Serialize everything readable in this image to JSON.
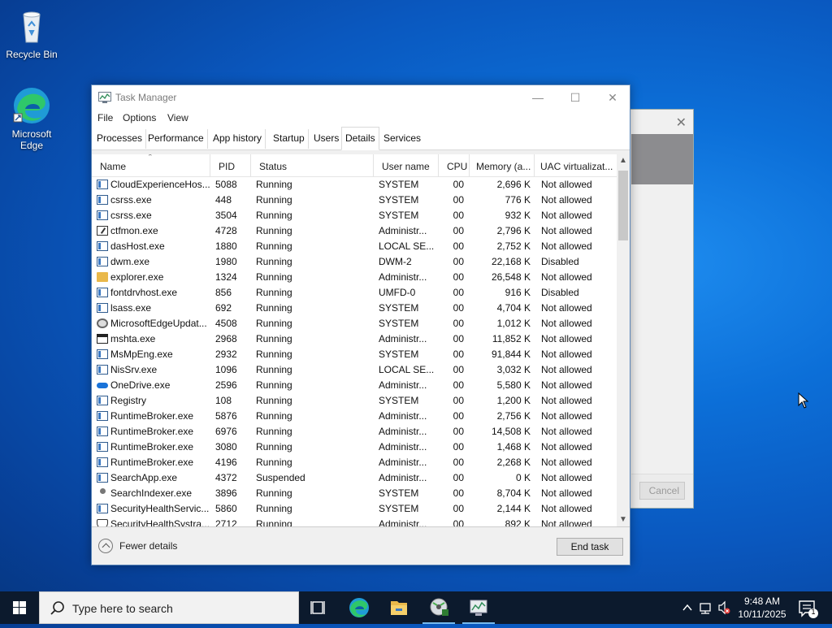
{
  "desktop": {
    "icons": [
      {
        "label": "Recycle Bin",
        "icon": "recycle-bin-icon"
      },
      {
        "label": "Microsoft Edge",
        "icon": "edge-icon"
      }
    ],
    "background_dialog": {
      "cancel_label": "Cancel"
    }
  },
  "task_manager": {
    "title": "Task Manager",
    "window_buttons": {
      "minimize": "—",
      "maximize": "☐",
      "close": "✕"
    },
    "menu": [
      "File",
      "Options",
      "View"
    ],
    "tabs": [
      "Processes",
      "Performance",
      "App history",
      "Startup",
      "Users",
      "Details",
      "Services"
    ],
    "active_tab": "Details",
    "columns": [
      "Name",
      "PID",
      "Status",
      "User name",
      "CPU",
      "Memory (a...",
      "UAC virtualizat..."
    ],
    "rows": [
      {
        "name": "CloudExperienceHos...",
        "pid": "5088",
        "status": "Running",
        "user": "SYSTEM",
        "cpu": "00",
        "mem": "2,696 K",
        "uac": "Not allowed",
        "icon": "app"
      },
      {
        "name": "csrss.exe",
        "pid": "448",
        "status": "Running",
        "user": "SYSTEM",
        "cpu": "00",
        "mem": "776 K",
        "uac": "Not allowed",
        "icon": "app"
      },
      {
        "name": "csrss.exe",
        "pid": "3504",
        "status": "Running",
        "user": "SYSTEM",
        "cpu": "00",
        "mem": "932 K",
        "uac": "Not allowed",
        "icon": "app"
      },
      {
        "name": "ctfmon.exe",
        "pid": "4728",
        "status": "Running",
        "user": "Administr...",
        "cpu": "00",
        "mem": "2,796 K",
        "uac": "Not allowed",
        "icon": "pen"
      },
      {
        "name": "dasHost.exe",
        "pid": "1880",
        "status": "Running",
        "user": "LOCAL SE...",
        "cpu": "00",
        "mem": "2,752 K",
        "uac": "Not allowed",
        "icon": "app"
      },
      {
        "name": "dwm.exe",
        "pid": "1980",
        "status": "Running",
        "user": "DWM-2",
        "cpu": "00",
        "mem": "22,168 K",
        "uac": "Disabled",
        "icon": "app"
      },
      {
        "name": "explorer.exe",
        "pid": "1324",
        "status": "Running",
        "user": "Administr...",
        "cpu": "00",
        "mem": "26,548 K",
        "uac": "Not allowed",
        "icon": "folder"
      },
      {
        "name": "fontdrvhost.exe",
        "pid": "856",
        "status": "Running",
        "user": "UMFD-0",
        "cpu": "00",
        "mem": "916 K",
        "uac": "Disabled",
        "icon": "app"
      },
      {
        "name": "lsass.exe",
        "pid": "692",
        "status": "Running",
        "user": "SYSTEM",
        "cpu": "00",
        "mem": "4,704 K",
        "uac": "Not allowed",
        "icon": "app"
      },
      {
        "name": "MicrosoftEdgeUpdat...",
        "pid": "4508",
        "status": "Running",
        "user": "SYSTEM",
        "cpu": "00",
        "mem": "1,012 K",
        "uac": "Not allowed",
        "icon": "gear"
      },
      {
        "name": "mshta.exe",
        "pid": "2968",
        "status": "Running",
        "user": "Administr...",
        "cpu": "00",
        "mem": "11,852 K",
        "uac": "Not allowed",
        "icon": "dark"
      },
      {
        "name": "MsMpEng.exe",
        "pid": "2932",
        "status": "Running",
        "user": "SYSTEM",
        "cpu": "00",
        "mem": "91,844 K",
        "uac": "Not allowed",
        "icon": "app"
      },
      {
        "name": "NisSrv.exe",
        "pid": "1096",
        "status": "Running",
        "user": "LOCAL SE...",
        "cpu": "00",
        "mem": "3,032 K",
        "uac": "Not allowed",
        "icon": "app"
      },
      {
        "name": "OneDrive.exe",
        "pid": "2596",
        "status": "Running",
        "user": "Administr...",
        "cpu": "00",
        "mem": "5,580 K",
        "uac": "Not allowed",
        "icon": "cloud"
      },
      {
        "name": "Registry",
        "pid": "108",
        "status": "Running",
        "user": "SYSTEM",
        "cpu": "00",
        "mem": "1,200 K",
        "uac": "Not allowed",
        "icon": "app"
      },
      {
        "name": "RuntimeBroker.exe",
        "pid": "5876",
        "status": "Running",
        "user": "Administr...",
        "cpu": "00",
        "mem": "2,756 K",
        "uac": "Not allowed",
        "icon": "app"
      },
      {
        "name": "RuntimeBroker.exe",
        "pid": "6976",
        "status": "Running",
        "user": "Administr...",
        "cpu": "00",
        "mem": "14,508 K",
        "uac": "Not allowed",
        "icon": "app"
      },
      {
        "name": "RuntimeBroker.exe",
        "pid": "3080",
        "status": "Running",
        "user": "Administr...",
        "cpu": "00",
        "mem": "1,468 K",
        "uac": "Not allowed",
        "icon": "app"
      },
      {
        "name": "RuntimeBroker.exe",
        "pid": "4196",
        "status": "Running",
        "user": "Administr...",
        "cpu": "00",
        "mem": "2,268 K",
        "uac": "Not allowed",
        "icon": "app"
      },
      {
        "name": "SearchApp.exe",
        "pid": "4372",
        "status": "Suspended",
        "user": "Administr...",
        "cpu": "00",
        "mem": "0 K",
        "uac": "Not allowed",
        "icon": "app"
      },
      {
        "name": "SearchIndexer.exe",
        "pid": "3896",
        "status": "Running",
        "user": "SYSTEM",
        "cpu": "00",
        "mem": "8,704 K",
        "uac": "Not allowed",
        "icon": "person"
      },
      {
        "name": "SecurityHealthServic...",
        "pid": "5860",
        "status": "Running",
        "user": "SYSTEM",
        "cpu": "00",
        "mem": "2,144 K",
        "uac": "Not allowed",
        "icon": "app"
      },
      {
        "name": "SecurityHealthSystra...",
        "pid": "2712",
        "status": "Running",
        "user": "Administr...",
        "cpu": "00",
        "mem": "892 K",
        "uac": "Not allowed",
        "icon": "shield"
      }
    ],
    "footer": {
      "fewer_details": "Fewer details",
      "end_task": "End task"
    }
  },
  "taskbar": {
    "search_placeholder": "Type here to search",
    "apps": [
      "task-view-icon",
      "edge-icon",
      "file-explorer-icon",
      "disc-app-icon",
      "task-manager-icon"
    ],
    "clock_time": "9:48 AM",
    "clock_date": "10/11/2025",
    "notification_count": "1"
  }
}
